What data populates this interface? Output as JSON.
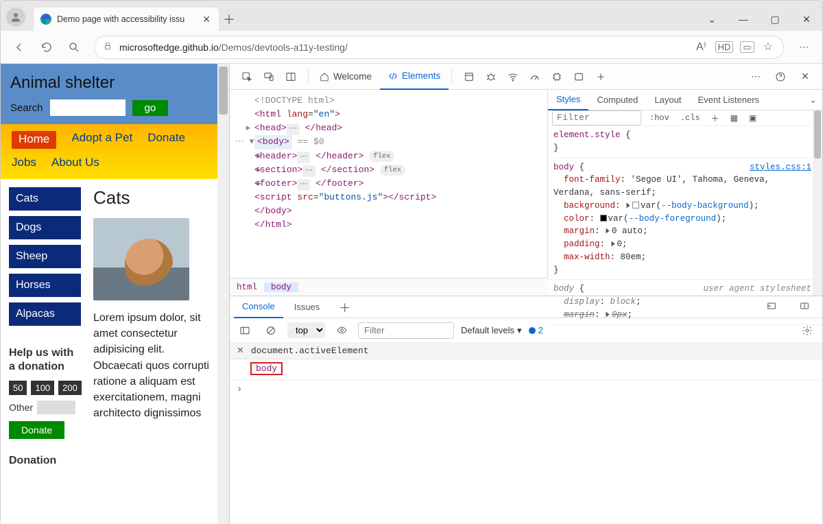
{
  "browser": {
    "tab_title": "Demo page with accessibility issu",
    "url_host": "microsoftedge.github.io",
    "url_path": "/Demos/devtools-a11y-testing/"
  },
  "site": {
    "title": "Animal shelter",
    "search_label": "Search",
    "search_placeholder": "",
    "go_label": "go",
    "nav": {
      "home": "Home",
      "adopt": "Adopt a Pet",
      "donate": "Donate",
      "jobs": "Jobs",
      "about": "About Us"
    },
    "categories": [
      "Cats",
      "Dogs",
      "Sheep",
      "Horses",
      "Alpacas"
    ],
    "help_heading": "Help us with a donation",
    "amounts": [
      "50",
      "100",
      "200"
    ],
    "other_label": "Other",
    "donate_btn": "Donate",
    "donation_heading": "Donation",
    "article_title": "Cats",
    "article_body": "Lorem ipsum dolor, sit amet consectetur adipisicing elit. Obcaecati quos corrupti ratione a aliquam est exercitationem, magni architecto dignissimos"
  },
  "devtools": {
    "tabs": {
      "welcome": "Welcome",
      "elements": "Elements"
    },
    "dom": {
      "l1": "<!DOCTYPE html>",
      "l2_open": "<html ",
      "l2_attr": "lang",
      "l2_val": "\"en\"",
      "l2_close": ">",
      "l3": "<head>",
      "l3b": "</head>",
      "l4": "<body>",
      "l4_eq": " == ",
      "l4_v": "$0",
      "l5a": "<header>",
      "l5b": "</header>",
      "l5_pill": "flex",
      "l6a": "<section>",
      "l6b": "</section>",
      "l6_pill": "flex",
      "l7a": "<footer>",
      "l7b": "</footer>",
      "l8a": "<script ",
      "l8_attr": "src",
      "l8_val": "\"buttons.js\"",
      "l8b": "></script>",
      "l9": "</body>",
      "l10": "</html>",
      "crumb_html": "html",
      "crumb_body": "body"
    },
    "styles": {
      "tabs": {
        "styles": "Styles",
        "computed": "Computed",
        "layout": "Layout",
        "events": "Event Listeners"
      },
      "filter_ph": "Filter",
      "hov": ":hov",
      "cls": ".cls",
      "rule1_sel": "element.style",
      "rule1_open": " {",
      "rule1_close": "}",
      "rule2_sel": "body",
      "rule2_open": " {",
      "rule2_link": "styles.css:1",
      "p_ff": "font-family",
      "v_ff": "'Segoe UI', Tahoma, Geneva, Verdana, sans-serif",
      "p_bg": "background",
      "v_bg_var": "--body-background",
      "p_col": "color",
      "v_col_var": "--body-foreground",
      "p_mar": "margin",
      "v_mar": "0 auto",
      "p_pad": "padding",
      "v_pad": "0",
      "p_mw": "max-width",
      "v_mw": "80em",
      "rule2_close": "}",
      "rule3_sel": "body",
      "rule3_ua": "user agent stylesheet",
      "p_disp": "display",
      "v_disp": "block",
      "p_mar2": "margin",
      "v_mar2": "0px"
    },
    "console": {
      "tab_console": "Console",
      "tab_issues": "Issues",
      "ctx": "top",
      "filter_ph": "Filter",
      "levels": "Default levels",
      "issues_count": "2",
      "expr": "document.activeElement",
      "result": "body"
    }
  }
}
